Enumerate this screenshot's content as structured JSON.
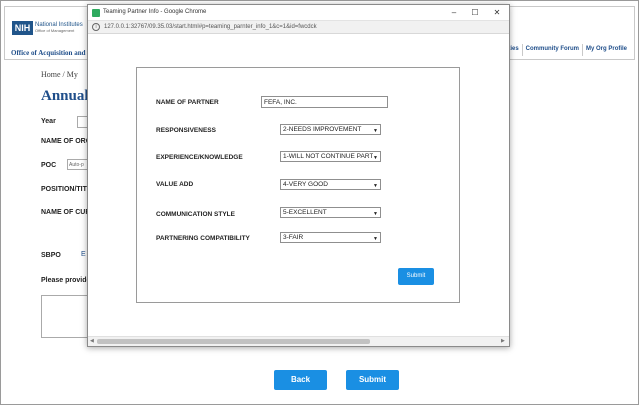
{
  "background": {
    "logo": "NIH",
    "org_name": "National Institutes",
    "org_sub": "Office of Management",
    "dept_link": "Office of Acquisition and L",
    "nav": [
      "dities",
      "Community Forum",
      "My Org Profile"
    ],
    "breadcrumb": "Home  /  My",
    "page_title": "Annual I",
    "labels": {
      "year": "Year",
      "name_of_org": "NAME OF ORG",
      "poc": "POC",
      "position": "POSITION/TIT",
      "name_of_cur": "NAME OF CUR",
      "sbpo": "SBPO",
      "please_provide": "Please provide"
    },
    "poc_select": "Auto-p",
    "sbpo_link": "E",
    "back_button": "Back",
    "submit_button": "Submit"
  },
  "popup": {
    "window_title": "Teaming Partner Info - Google Chrome",
    "url": "127.0.0.1:32767/09.35.03/start.html#p=teaming_parnter_info_1&c=1&id=fwcdck",
    "controls": {
      "minimize": "–",
      "maximize": "☐",
      "close": "✕"
    },
    "form": {
      "name_of_partner_label": "NAME OF PARTNER",
      "name_of_partner_value": "FEFA, INC.",
      "fields": [
        {
          "label": "RESPONSIVENESS",
          "value": "2-NEEDS IMPROVEMENT"
        },
        {
          "label": "EXPERIENCE/KNOWLEDGE",
          "value": "1-WILL NOT CONTINUE PARTNE"
        },
        {
          "label": "VALUE ADD",
          "value": "4-VERY GOOD"
        },
        {
          "label": "COMMUNICATION STYLE",
          "value": "5-EXCELLENT"
        },
        {
          "label": "PARTNERING COMPATIBILITY",
          "value": "3-FAIR"
        }
      ],
      "submit_label": "Submit"
    }
  },
  "colors": {
    "accent_blue": "#1a8fe3",
    "nih_blue": "#20558a",
    "link_blue": "#1f4e8a"
  }
}
